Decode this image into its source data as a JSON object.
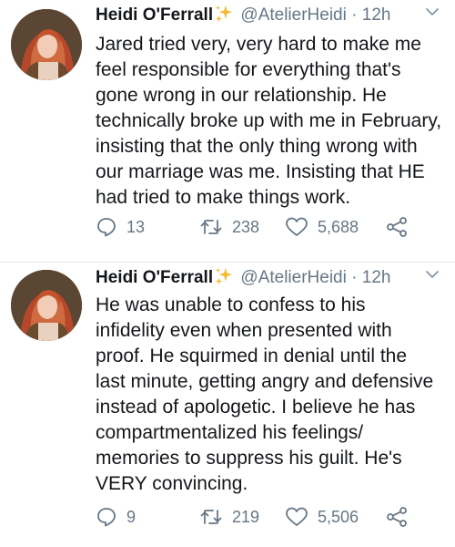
{
  "tweets": [
    {
      "display_name": "Heidi O'Ferrall",
      "handle": "@AtelierHeidi",
      "separator": "·",
      "time": "12h",
      "text": "Jared tried very, very hard to make me\nfeel responsible for everything that's\ngone wrong in our relationship. He\ntechnically broke up with me in February,\ninsisting that the only thing wrong with\nour marriage was me. Insisting that HE\nhad tried to make things work.",
      "replies": "13",
      "retweets": "238",
      "likes": "5,688"
    },
    {
      "display_name": "Heidi O'Ferrall",
      "handle": "@AtelierHeidi",
      "separator": "·",
      "time": "12h",
      "text": "He was unable to confess to his\ninfidelity even when presented with\nproof. He squirmed in denial until the\nlast minute, getting angry and defensive\ninstead of apologetic. I believe he has\ncompartmentalized his feelings/\nmemories to suppress his guilt. He's\nVERY convincing.",
      "replies": "9",
      "retweets": "219",
      "likes": "5,506"
    }
  ],
  "colors": {
    "text": "#14171a",
    "secondary": "#657786",
    "sparkle": "#f5b82e",
    "divider": "#e1e8ed"
  },
  "icons": {
    "reply": "speech-bubble-icon",
    "retweet": "retweet-arrows-icon",
    "like": "heart-outline-icon",
    "share": "share-nodes-icon",
    "menu": "chevron-down-icon",
    "verified_emoji": "sparkles-icon"
  }
}
